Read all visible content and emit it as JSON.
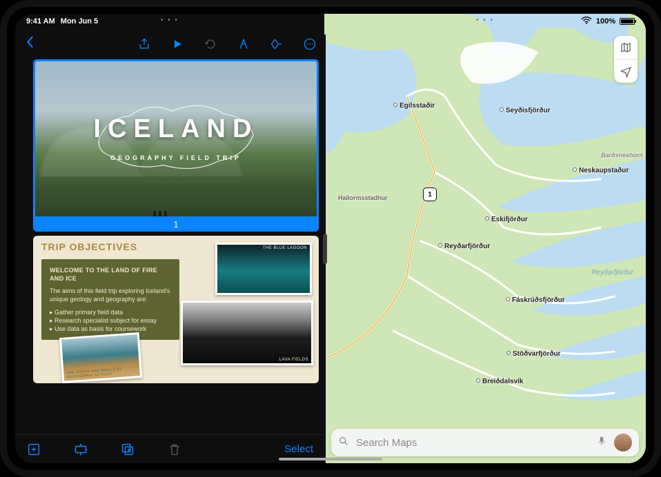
{
  "status": {
    "time": "9:41 AM",
    "date": "Mon Jun 5",
    "battery": "100%"
  },
  "keynote": {
    "slide1": {
      "title": "ICELAND",
      "subtitle": "GEOGRAPHY FIELD TRIP",
      "number": "1"
    },
    "slide2": {
      "header": "TRIP OBJECTIVES",
      "panel_title": "WELCOME TO THE LAND OF FIRE AND ICE",
      "panel_intro": "The aims of this field trip exploring Iceland's unique geology and geography are:",
      "bullets": [
        "Gather primary field data",
        "Research specialist subject for essay",
        "Use data as basis for coursework"
      ],
      "photo1_label": "THE BLUE LAGOON",
      "photo2_label": "LAVA FIELDS",
      "photo3_label": "THE SIGHTS AND SMELLS OF GEOTHERMAL ACTIVITY"
    },
    "select_label": "Select"
  },
  "maps": {
    "search_placeholder": "Search Maps",
    "route": "1",
    "places": {
      "egilsstadir": "Egilsstaðir",
      "seydisfjordur": "Seyðisfjörður",
      "neskaupstadur": "Neskaupstaður",
      "eskifjordur": "Eskifjörður",
      "reydarfjordur": "Reyðarfjörður",
      "faskrudsfjordur": "Fáskrúðsfjörður",
      "stodvarfjordur": "Stöðvarfjörður",
      "breiddalsvik": "Breiðdalsvík",
      "hallormsstadhur": "Hallormsstadhur",
      "bardsneshorn": "Barðsneshorn",
      "reydarfjordur_sea": "Reyðarfjörður"
    }
  }
}
